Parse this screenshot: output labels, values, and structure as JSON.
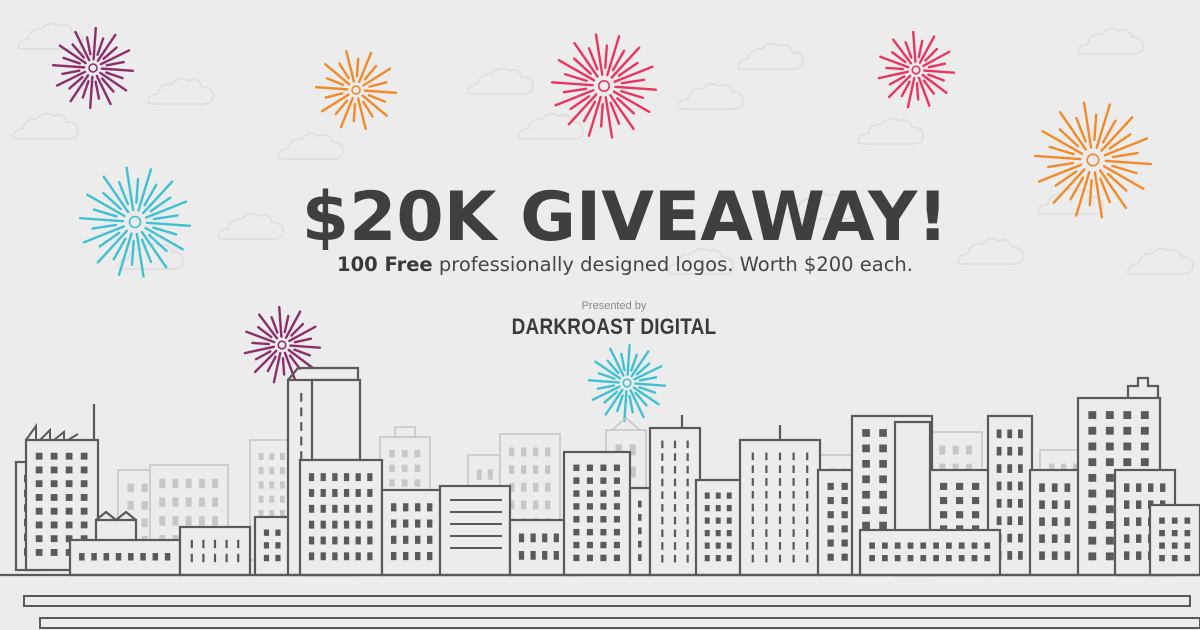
{
  "headline": "$20K GIVEAWAY!",
  "subheadline": {
    "strong": "100 Free",
    "rest": " professionally designed logos. Worth $200 each."
  },
  "presented_label": "Presented by",
  "brand_name": "DARKROAST DIGITAL",
  "colors": {
    "background": "#ececec",
    "text": "#3f3f3f",
    "line": "#5a5a5a",
    "line_light": "#c7c7c7",
    "firework_purple": "#8b2f6b",
    "firework_orange": "#f08a2a",
    "firework_pink": "#e8365f",
    "firework_cyan": "#3fc1d3"
  },
  "illustration": {
    "fireworks": [
      "purple-firework-icon",
      "orange-firework-icon",
      "pink-firework-icon",
      "pink-firework-icon",
      "orange-firework-icon",
      "cyan-firework-icon",
      "purple-firework-icon",
      "cyan-firework-icon"
    ],
    "skyline": "city-skyline-illustration",
    "clouds": "cloud-outline-icon"
  }
}
